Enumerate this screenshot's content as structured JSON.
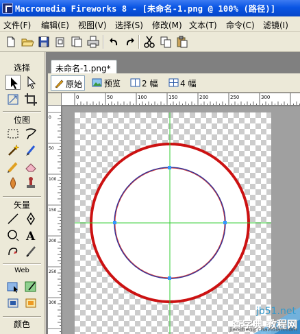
{
  "window": {
    "title": "Macromedia Fireworks 8 - [未命名-1.png @ 100% (路径)]"
  },
  "menu": [
    {
      "label": "文件(F)"
    },
    {
      "label": "编辑(E)"
    },
    {
      "label": "视图(V)"
    },
    {
      "label": "选择(S)"
    },
    {
      "label": "修改(M)"
    },
    {
      "label": "文本(T)"
    },
    {
      "label": "命令(C)"
    },
    {
      "label": "滤镜(I)"
    }
  ],
  "toolbar": {
    "icons": [
      "new-file-icon",
      "open-folder-icon",
      "save-icon",
      "import-icon",
      "export-icon",
      "print-icon",
      "undo-icon",
      "redo-icon",
      "cut-icon",
      "copy-icon",
      "paste-icon"
    ]
  },
  "tools_panel": {
    "sections": [
      {
        "label": "选择"
      },
      {
        "label": "位图"
      },
      {
        "label": "矢量"
      },
      {
        "label": "Web"
      },
      {
        "label": "颜色"
      }
    ]
  },
  "document": {
    "tab_label": "未命名-1.png*",
    "view_tabs": [
      {
        "label": "原始",
        "selected": true,
        "icon": "pencil-icon"
      },
      {
        "label": "预览",
        "selected": false,
        "icon": "image-preview-icon"
      },
      {
        "label": "2 幅",
        "selected": false,
        "icon": "two-up-icon"
      },
      {
        "label": "4 幅",
        "selected": false,
        "icon": "four-up-icon"
      }
    ],
    "ruler_top": [
      "0",
      "50",
      "100",
      "150",
      "200",
      "250",
      "300"
    ],
    "ruler_left": [
      "0",
      "50",
      "100",
      "150",
      "200",
      "250",
      "300"
    ],
    "shapes": {
      "outer_circle_color": "#cc1111",
      "inner_circle_color": "#333399",
      "guide_color": "#33cc33",
      "anchor_color": "#3399ff"
    }
  },
  "watermark": {
    "site": "jb51.net",
    "name": "查字典 教程网",
    "url": "jiaocheng.chazidian.com"
  }
}
